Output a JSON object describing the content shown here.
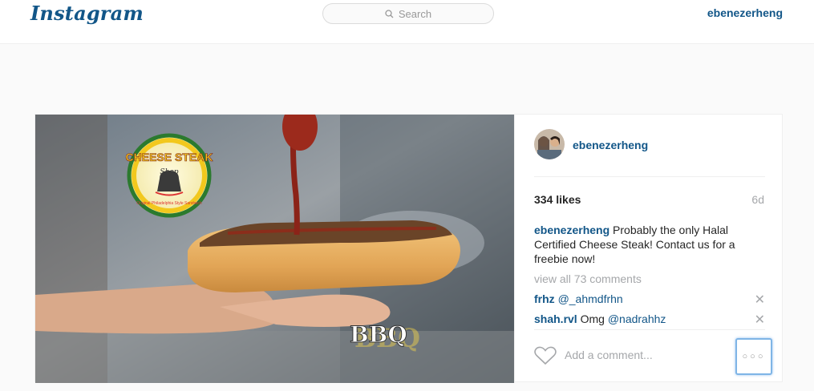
{
  "header": {
    "logo": "Instagram",
    "search_placeholder": "Search",
    "username": "ebenezerheng"
  },
  "post": {
    "image": {
      "logo_text": "CHEESE STEAK",
      "logo_subtext": "Shop",
      "logo_tagline": "Original Philadelphia Style Sandwich",
      "overlay_text": "BBQ"
    },
    "author": "ebenezerheng",
    "likes": "334 likes",
    "time": "6d",
    "caption_user": "ebenezerheng",
    "caption_text": " Probably the only Halal Certified Cheese Steak! Contact us for a freebie now!",
    "view_all": "view all 73 comments",
    "comments": [
      {
        "user": "frhz",
        "text": "",
        "mention": "@_ahmdfrhn"
      },
      {
        "user": "shah.rvl",
        "text": " Omg ",
        "mention": "@nadrahhz"
      }
    ],
    "add_comment_placeholder": "Add a comment...",
    "more_label": "○○○"
  },
  "colors": {
    "link": "#125688",
    "muted": "#a5a7aa",
    "focus": "#7fb5e6"
  }
}
